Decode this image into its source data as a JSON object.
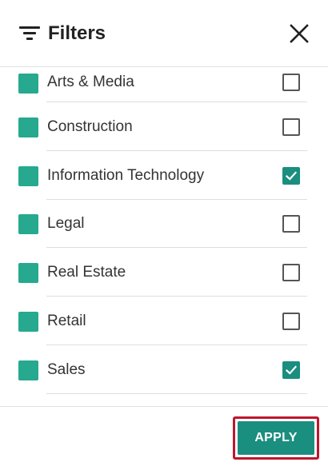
{
  "header": {
    "title": "Filters",
    "filter_icon": "filter-list-icon",
    "close_icon": "close-icon"
  },
  "filters": {
    "items": [
      {
        "label": "Arts & Media",
        "checked": false
      },
      {
        "label": "Construction",
        "checked": false
      },
      {
        "label": "Information Technology",
        "checked": true
      },
      {
        "label": "Legal",
        "checked": false
      },
      {
        "label": "Real Estate",
        "checked": false
      },
      {
        "label": "Retail",
        "checked": false
      },
      {
        "label": "Sales",
        "checked": true
      }
    ]
  },
  "footer": {
    "apply_label": "APPLY"
  },
  "colors": {
    "swatch": "#26a98f",
    "accent": "#1a8e7f",
    "highlight_outline": "#c0162e"
  }
}
